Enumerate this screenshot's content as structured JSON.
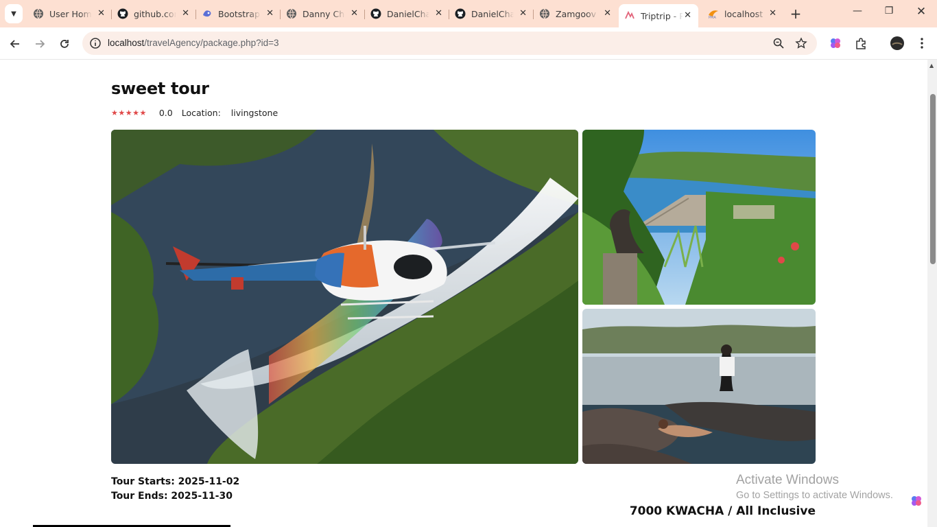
{
  "browser": {
    "tabs": [
      {
        "title": "User Home",
        "icon": "globe-icon"
      },
      {
        "title": "github.com",
        "icon": "github-icon"
      },
      {
        "title": "Bootstrap",
        "icon": "bootstrap-icon"
      },
      {
        "title": "Danny Ch",
        "icon": "globe-icon"
      },
      {
        "title": "DanielCha",
        "icon": "github-icon"
      },
      {
        "title": "DanielCha",
        "icon": "github-icon"
      },
      {
        "title": "Zamgoov",
        "icon": "globe-icon"
      },
      {
        "title": "Triptrip - P",
        "icon": "triptrip-icon",
        "active": true
      },
      {
        "title": "localhost",
        "icon": "phpmyadmin-icon"
      }
    ],
    "url_host": "localhost",
    "url_path": "/travelAgency/package.php?id=3"
  },
  "package": {
    "title": "sweet tour",
    "stars": "★★★★★",
    "rating": "0.0",
    "location_label": "Location:",
    "location": "livingstone",
    "tour_starts": "Tour Starts: 2025-11-02",
    "tour_ends": "Tour Ends: 2025-11-30",
    "price": "7000 KWACHA / All Inclusive"
  },
  "images": [
    {
      "name": "helicopter over waterfall with rainbow"
    },
    {
      "name": "dam and lake view"
    },
    {
      "name": "people at waterfall rock pool"
    }
  ],
  "watermark": {
    "line1": "Activate Windows",
    "line2": "Go to Settings to activate Windows."
  },
  "colors": {
    "tab_bar": "#fde0d2",
    "omnibox": "#fbeee8",
    "star": "#e04848"
  }
}
